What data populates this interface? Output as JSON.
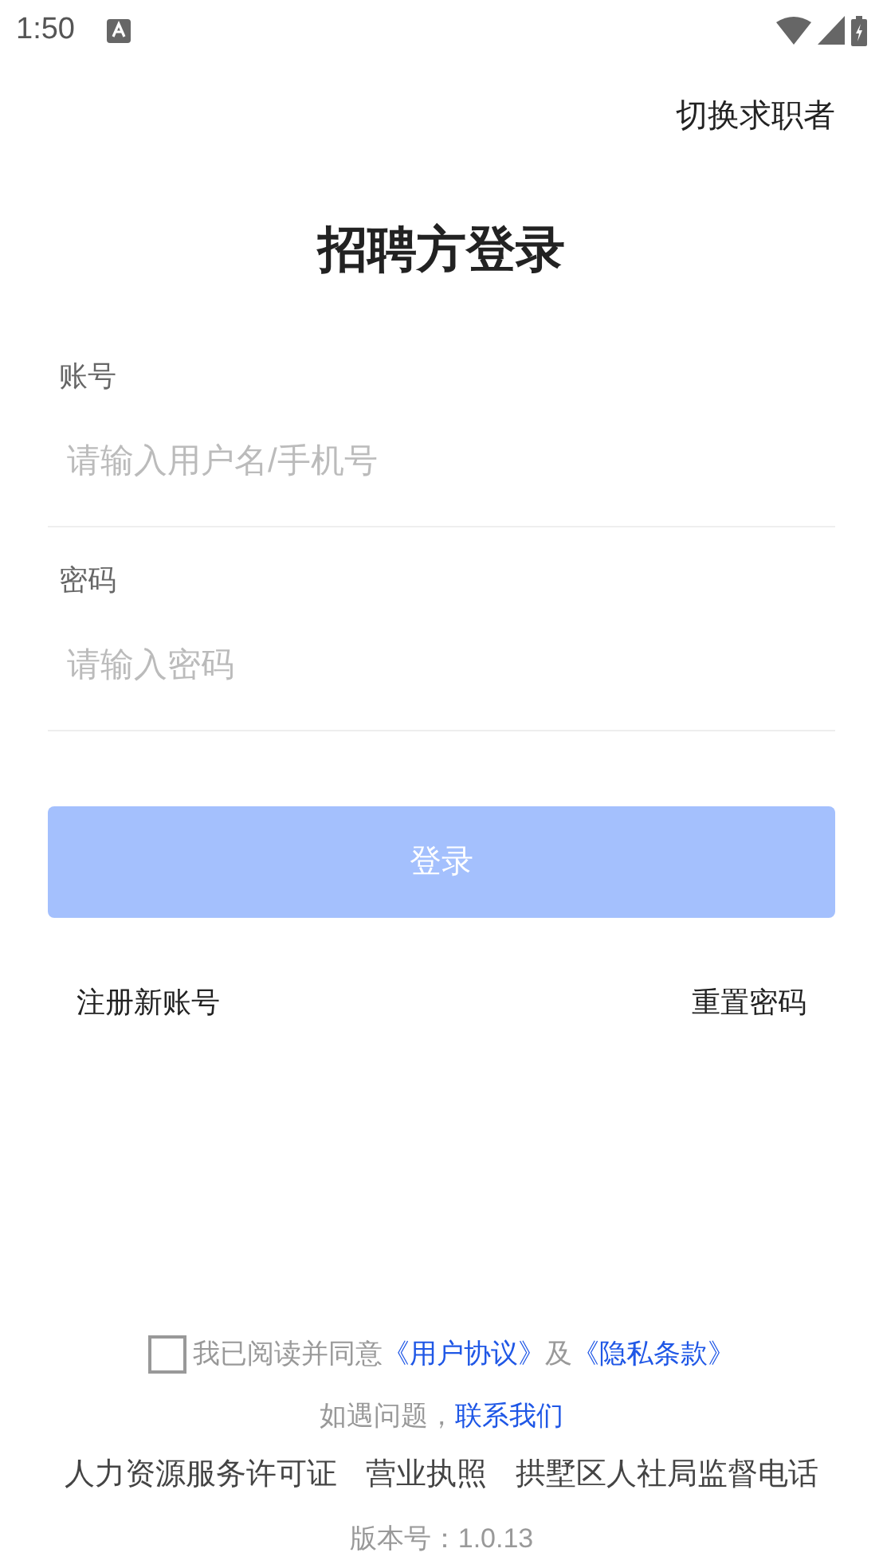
{
  "status_bar": {
    "time": "1:50"
  },
  "switch_link": "切换求职者",
  "title": "招聘方登录",
  "fields": [
    {
      "label": "账号",
      "placeholder": "请输入用户名/手机号"
    },
    {
      "label": "密码",
      "placeholder": "请输入密码"
    }
  ],
  "login_button": {
    "label": "登录",
    "disabled": true
  },
  "links": [
    "注册新账号",
    "重置密码"
  ],
  "agreement": {
    "checked": false,
    "parts": [
      {
        "kind": "text",
        "text": "我已阅读并同意"
      },
      {
        "kind": "link",
        "text": "《用户协议》"
      },
      {
        "kind": "text",
        "text": "及"
      },
      {
        "kind": "link",
        "text": "《隐私条款》"
      }
    ]
  },
  "help": [
    {
      "kind": "text",
      "text": "如遇问题，"
    },
    {
      "kind": "link",
      "text": "联系我们"
    }
  ],
  "footer_links": [
    "人力资源服务许可证",
    "营业执照",
    "拱墅区人社局监督电话"
  ],
  "version": "版本号：1.0.13"
}
